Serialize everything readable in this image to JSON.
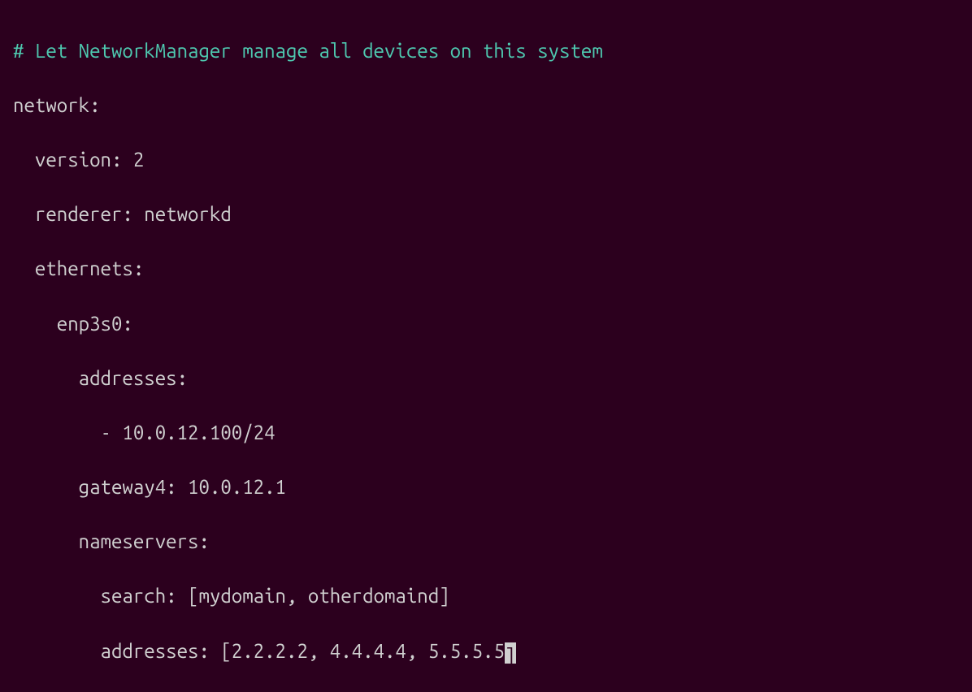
{
  "lines": {
    "comment": "# Let NetworkManager manage all devices on this system",
    "l1": "network:",
    "l2": "  version: 2",
    "l3": "  renderer: networkd",
    "l4": "  ethernets:",
    "l5": "    enp3s0:",
    "l6": "      addresses:",
    "l7": "        - 10.0.12.100/24",
    "l8": "      gateway4: 10.0.12.1",
    "l9": "      nameservers:",
    "l10": "        search: [mydomain, otherdomaind]",
    "l11_a": "        addresses: [2.2.2.2, 4.4.4.4, 5.5.5.5",
    "l11_cursor": "]"
  }
}
